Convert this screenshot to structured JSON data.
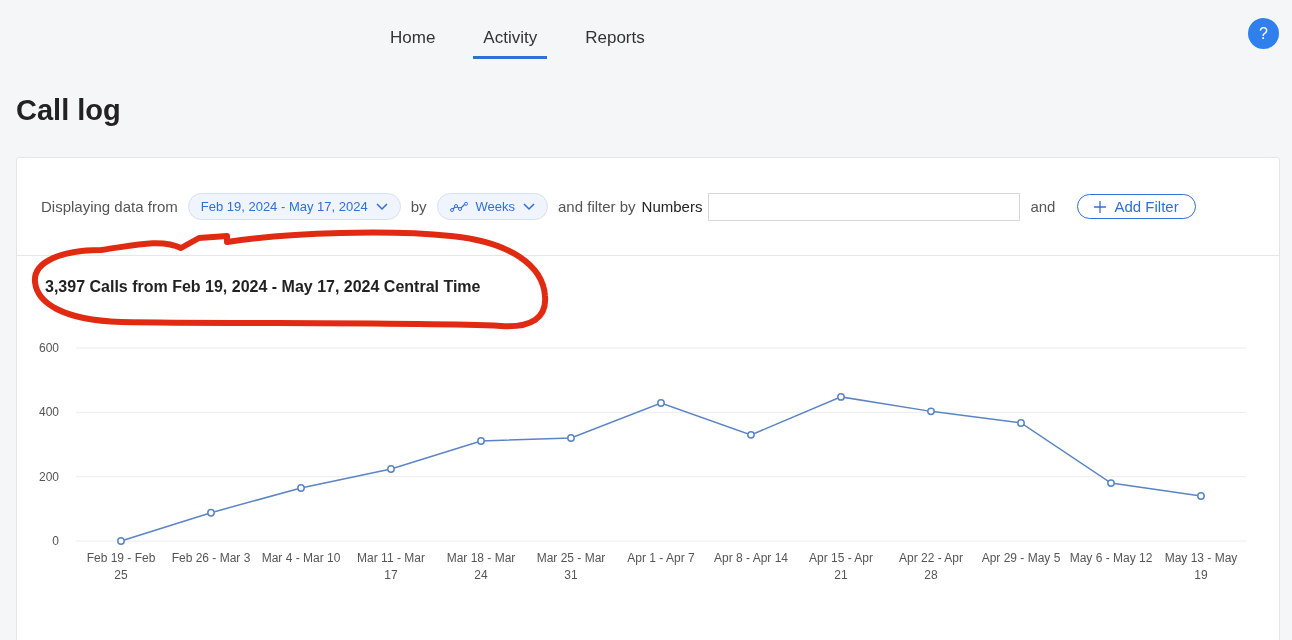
{
  "nav": {
    "tabs": [
      {
        "label": "Home",
        "selected": false
      },
      {
        "label": "Activity",
        "selected": true
      },
      {
        "label": "Reports",
        "selected": false
      }
    ],
    "help_button": "?"
  },
  "page_title": "Call log",
  "filters": {
    "prefix": "Displaying data from",
    "date_range": "Feb 19, 2024 - May 17, 2024",
    "by": "by",
    "interval": "Weeks",
    "filter_by": "and filter by",
    "filter_field_label": "Numbers",
    "and": "and",
    "add_filter": "Add Filter"
  },
  "chart_heading": "3,397 Calls from Feb 19, 2024 - May 17, 2024 Central Time",
  "chart_data": {
    "type": "line",
    "categories": [
      "Feb 19 - Feb 25",
      "Feb 26 - Mar 3",
      "Mar 4 - Mar 10",
      "Mar 11 - Mar 17",
      "Mar 18 - Mar 24",
      "Mar 25 - Mar 31",
      "Apr 1 - Apr 7",
      "Apr 8 - Apr 14",
      "Apr 15 - Apr 21",
      "Apr 22 - Apr 28",
      "Apr 29 - May 5",
      "May 6 - May 12",
      "May 13 - May 19"
    ],
    "series": [
      {
        "color": "#5b84c4",
        "marker": "circle",
        "values": [
          0,
          88,
          165,
          224,
          311,
          320,
          429,
          330,
          448,
          403,
          367,
          180,
          140
        ]
      }
    ],
    "ylim": [
      0,
      600
    ],
    "yticks": [
      0,
      200,
      400,
      600
    ]
  }
}
